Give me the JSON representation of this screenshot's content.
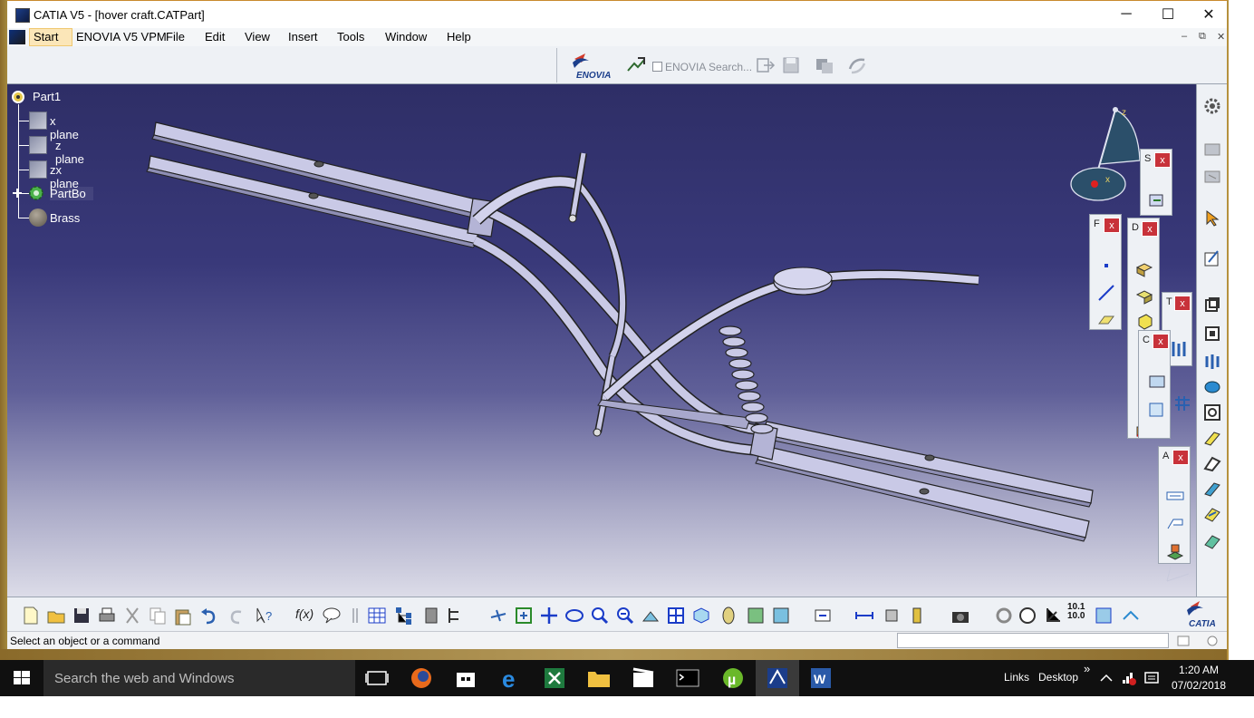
{
  "window": {
    "title": "CATIA V5 - [hover craft.CATPart]",
    "minimize": "─",
    "maximize": "☐",
    "close": "✕"
  },
  "menu": {
    "start": "Start",
    "items": [
      "ENOVIA V5 VPM",
      "File",
      "Edit",
      "View",
      "Insert",
      "Tools",
      "Window",
      "Help"
    ],
    "doc_minimize": "–",
    "doc_restore": "⧉",
    "doc_close": "✕"
  },
  "enovia": {
    "logo_text": "ENOVIA",
    "search_label": "ENOVIA Search..."
  },
  "tree": {
    "root": "Part1",
    "nodes": [
      "x   plane",
      "z plane",
      "zx plane",
      "PartBo",
      "Brass"
    ]
  },
  "compass": {
    "z_label": "z",
    "x_label": "x"
  },
  "palettes": {
    "s": "S",
    "f": "F",
    "d": "D",
    "t": "T",
    "c": "C",
    "a": "A",
    "close": "x"
  },
  "bottom_toolbar": {
    "formula": "f(x)",
    "ratio_top": "10.1",
    "ratio_bottom": "10.0",
    "catia_logo": "CATIA"
  },
  "status": {
    "text": "Select an object or a command"
  },
  "taskbar": {
    "search_placeholder": "Search the web and Windows",
    "links": "Links",
    "desktop": "Desktop",
    "chevron": "»",
    "time": "1:20 AM",
    "date": "07/02/2018"
  },
  "colors": {
    "viewport_top": "#2e2e66",
    "viewport_bottom": "#dcdce8",
    "part_color": "#c9c9e6",
    "palette_close": "#c8323a",
    "taskbar": "#101010"
  }
}
